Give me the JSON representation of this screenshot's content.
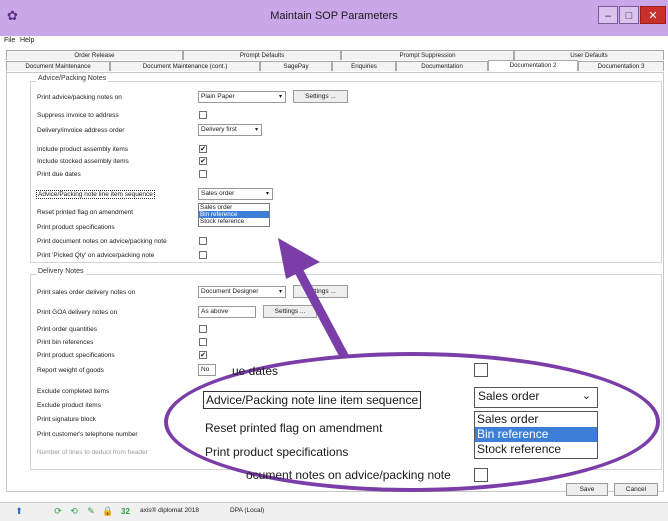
{
  "window": {
    "title": "Maintain SOP Parameters",
    "minimize": "–",
    "maximize": "□",
    "close": "✕"
  },
  "menu": [
    "File",
    "Help"
  ],
  "tabs_top": [
    "Order Release",
    "Prompt Defaults",
    "Prompt Suppression",
    "User Defaults"
  ],
  "tabs_bottom": [
    "Document Maintenance",
    "Document Maintenance (cont.)",
    "SagePay",
    "Enquiries",
    "Documentation",
    "Documentation 2",
    "Documentation 3"
  ],
  "advice": {
    "title": "Advice/Packing Notes",
    "print_on_label": "Print advice/packing notes on",
    "print_on_value": "Plain Paper",
    "settings": "Settings ...",
    "suppress_invoice": "Suppress invoice to address",
    "address_order_label": "Delivery/invoice address order",
    "address_order_value": "Delivery first",
    "include_product_assembly": "Include product assembly items",
    "include_stocked_assembly": "Include stocked assembly items",
    "print_due_dates": "Print due dates",
    "line_seq_label": "Advice/Packing note line item sequence",
    "line_seq_value": "Sales order",
    "line_seq_options": [
      "Sales order",
      "Bin reference",
      "Stock reference"
    ],
    "reset_printed": "Reset printed flag on amendment",
    "print_product_specs": "Print product specifications",
    "print_doc_notes": "Print document notes on advice/packing note",
    "print_picked_qty": "Print 'Picked Qty' on advice/packing note"
  },
  "delivery": {
    "title": "Delivery Notes",
    "print_sales_label": "Print sales order delivery notes on",
    "print_sales_value": "Document Designer",
    "settings": "Settings ...",
    "print_goa_label": "Print GOA delivery notes on",
    "print_goa_value": "As above",
    "print_order_qty": "Print order quantities",
    "print_bin_refs": "Print bin references",
    "print_product_specs": "Print product specifications",
    "report_weight": "Report weight of goods",
    "report_weight_value": "No",
    "exclude_completed": "Exclude completed items",
    "exclude_product": "Exclude product items",
    "print_signature": "Print signature block",
    "print_phone": "Print customer's telephone number",
    "lines_deduct": "Number of lines to deduct from header"
  },
  "footer": {
    "save": "Save",
    "cancel": "Cancel"
  },
  "status": {
    "count": "32",
    "product": "axis® diplomat 2018",
    "company": "DPA (Local)"
  },
  "zoom": {
    "due_dates": "ue dates",
    "line_seq_label": "Advice/Packing note line item sequence",
    "line_seq_value": "Sales order",
    "options": [
      "Sales order",
      "Bin reference",
      "Stock reference"
    ],
    "reset_printed": "Reset printed flag on amendment",
    "print_product_specs": "Print product specifications",
    "print_doc_notes": "ocument notes on advice/packing note"
  },
  "colors": {
    "accent": "#7b3ea9",
    "title_bar": "#c9a7e8",
    "selection": "#3d7fd6"
  }
}
